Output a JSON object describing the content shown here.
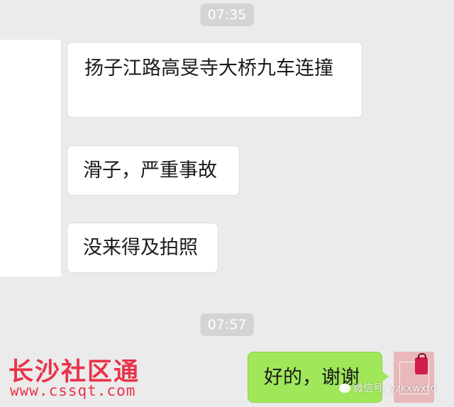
{
  "timestamps": [
    "07:35",
    "07:57"
  ],
  "messages": [
    {
      "direction": "incoming",
      "text": "扬子江路高旻寺大桥九车连撞"
    },
    {
      "direction": "incoming",
      "text": "滑子，严重事故"
    },
    {
      "direction": "incoming",
      "text": "没来得及拍照"
    },
    {
      "direction": "outgoing",
      "text": "好的，谢谢"
    }
  ],
  "watermarks": {
    "logo_text": "长沙社区通",
    "url": "www.cssqt.com",
    "wechat_id": "微信号: yzkxwxtd"
  },
  "colors": {
    "background": "#ebebeb",
    "incoming_bubble": "#ffffff",
    "outgoing_bubble": "#a0e75a",
    "watermark_red": "#e8334a"
  }
}
